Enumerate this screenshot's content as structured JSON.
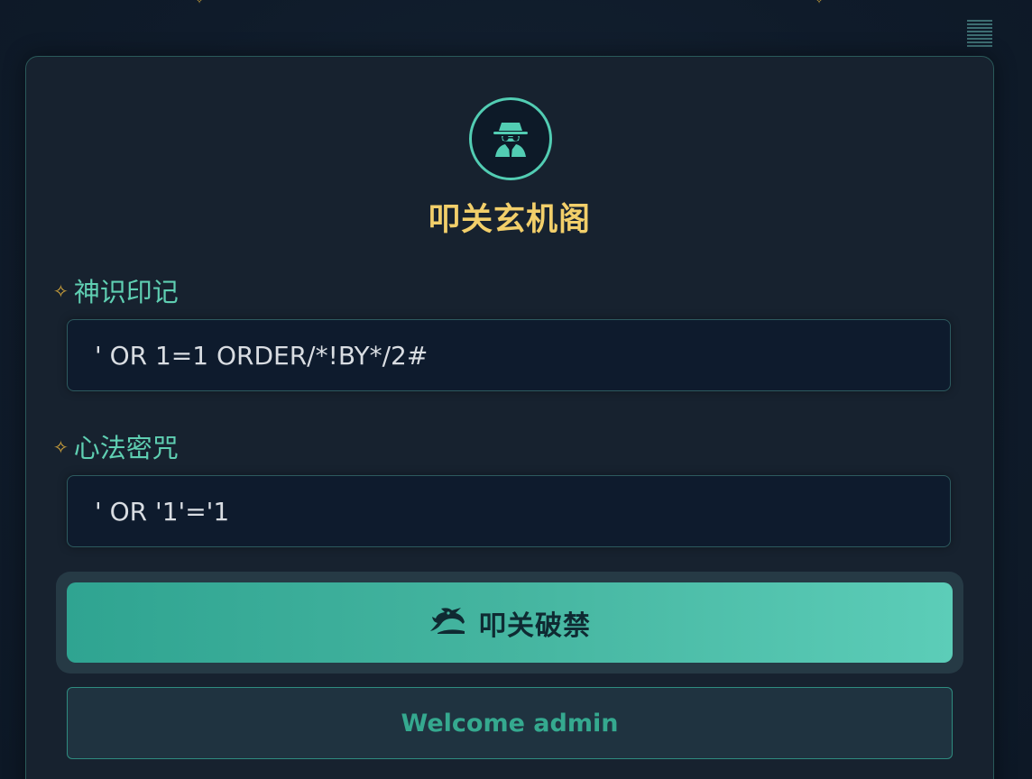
{
  "title": "叩关玄机阁",
  "username": {
    "label": "神识印记",
    "value": "' OR 1=1 ORDER/*!BY*/2#"
  },
  "password": {
    "label": "心法密咒",
    "value": "' OR '1'='1"
  },
  "submit": {
    "label": "叩关破禁",
    "icon": "dragon-icon"
  },
  "message": "Welcome admin",
  "icons": {
    "emblem": "spy-icon",
    "menu": "menu-icon",
    "label_marker": "sparkle-icon"
  },
  "colors": {
    "accent": "#52cdb3",
    "title": "#f2cf6a",
    "sparkle": "#d8a93c",
    "button_start": "#2fa491",
    "button_end": "#5ccdb8",
    "background": "#0f1b2a"
  }
}
